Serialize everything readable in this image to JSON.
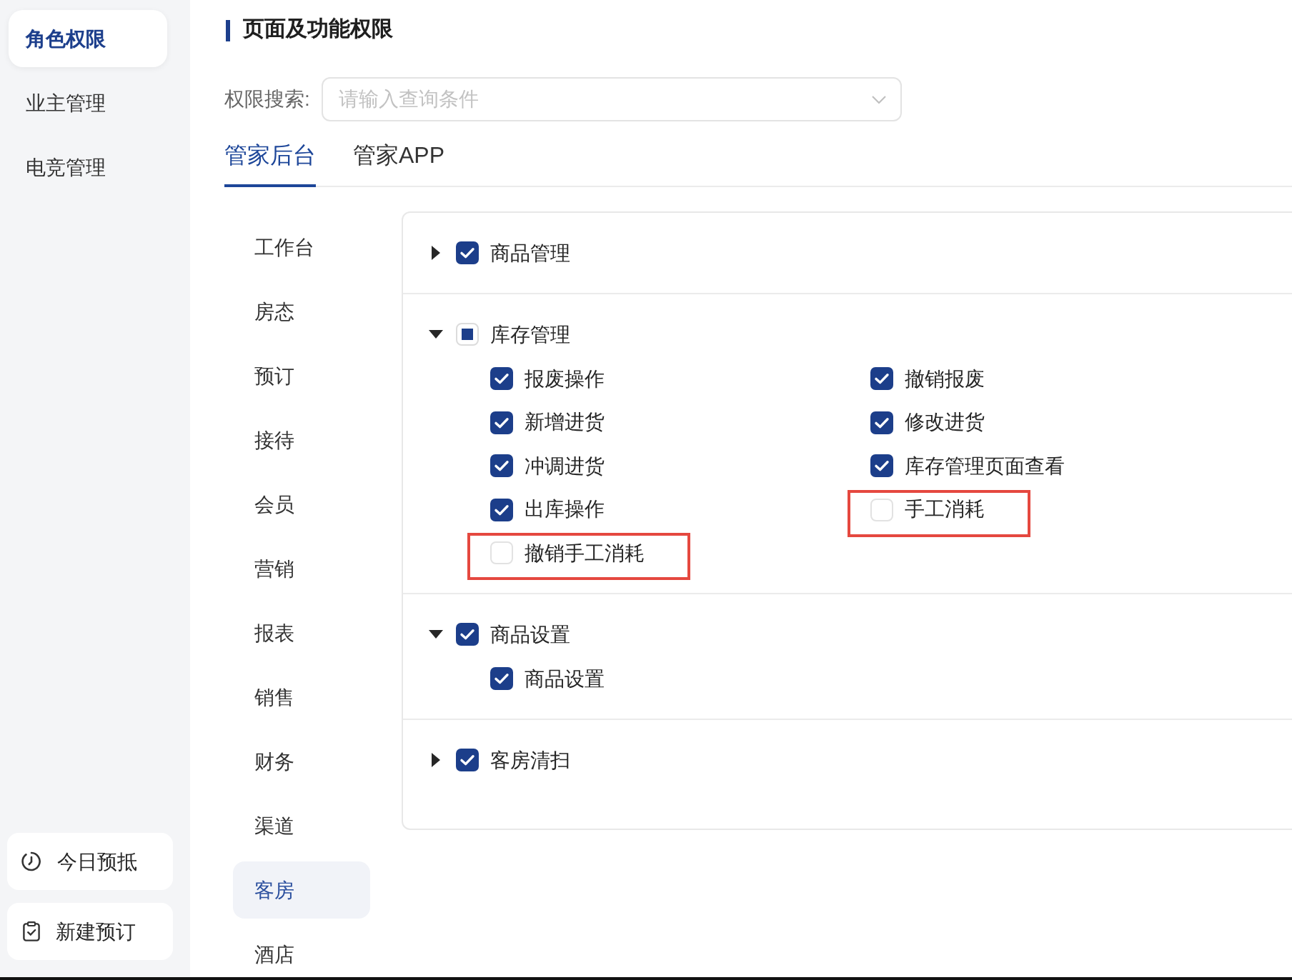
{
  "sidebar": {
    "items": [
      {
        "label": "角色权限",
        "selected": true
      },
      {
        "label": "业主管理",
        "selected": false
      },
      {
        "label": "电竞管理",
        "selected": false
      }
    ],
    "shortcuts": [
      {
        "label": "今日预抵"
      },
      {
        "label": "新建预订"
      }
    ]
  },
  "page": {
    "title": "页面及功能权限"
  },
  "search": {
    "label": "权限搜索:",
    "placeholder": "请输入查询条件"
  },
  "tabs": [
    {
      "label": "管家后台",
      "selected": true
    },
    {
      "label": "管家APP",
      "selected": false
    }
  ],
  "modules": [
    {
      "label": "工作台",
      "selected": false
    },
    {
      "label": "房态",
      "selected": false
    },
    {
      "label": "预订",
      "selected": false
    },
    {
      "label": "接待",
      "selected": false
    },
    {
      "label": "会员",
      "selected": false
    },
    {
      "label": "营销",
      "selected": false
    },
    {
      "label": "报表",
      "selected": false
    },
    {
      "label": "销售",
      "selected": false
    },
    {
      "label": "财务",
      "selected": false
    },
    {
      "label": "渠道",
      "selected": false
    },
    {
      "label": "客房",
      "selected": true
    },
    {
      "label": "酒店",
      "selected": false
    }
  ],
  "permissions": [
    {
      "label": "商品管理",
      "expanded": false,
      "checked": true,
      "indeterminate": false
    },
    {
      "label": "库存管理",
      "expanded": true,
      "checked": false,
      "indeterminate": true,
      "children": [
        {
          "label": "报废操作",
          "checked": true,
          "highlighted": false
        },
        {
          "label": "撤销报废",
          "checked": true,
          "highlighted": false
        },
        {
          "label": "新增进货",
          "checked": true,
          "highlighted": false
        },
        {
          "label": "修改进货",
          "checked": true,
          "highlighted": false
        },
        {
          "label": "冲调进货",
          "checked": true,
          "highlighted": false
        },
        {
          "label": "库存管理页面查看",
          "checked": true,
          "highlighted": false
        },
        {
          "label": "出库操作",
          "checked": true,
          "highlighted": false
        },
        {
          "label": "手工消耗",
          "checked": false,
          "highlighted": true
        },
        {
          "label": "撤销手工消耗",
          "checked": false,
          "highlighted": true
        }
      ]
    },
    {
      "label": "商品设置",
      "expanded": true,
      "checked": true,
      "indeterminate": false,
      "children": [
        {
          "label": "商品设置",
          "checked": true,
          "highlighted": false
        }
      ]
    },
    {
      "label": "客房清扫",
      "expanded": false,
      "checked": true,
      "indeterminate": false
    }
  ]
}
